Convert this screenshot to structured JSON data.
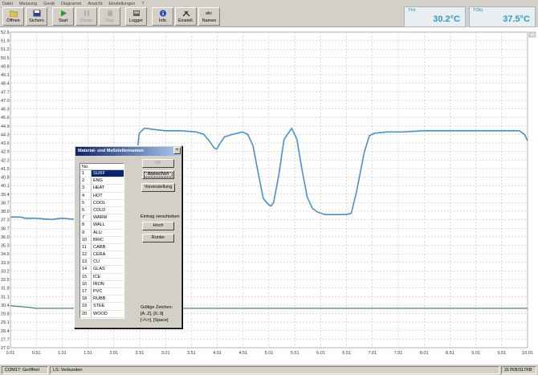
{
  "menu": [
    "Datei",
    "Messung",
    "Gerät",
    "Diagramm",
    "Ansicht",
    "Einstellungen",
    "?"
  ],
  "toolbar": [
    {
      "label": "Öffnen",
      "icon": "folder-icon",
      "enabled": true
    },
    {
      "label": "Sichern",
      "icon": "save-icon",
      "enabled": true
    },
    {
      "label": "Start",
      "icon": "play-icon",
      "enabled": true
    },
    {
      "label": "Pause",
      "icon": "pause-icon",
      "enabled": false
    },
    {
      "label": "Stop",
      "icon": "stop-icon",
      "enabled": false
    },
    {
      "label": "Logger",
      "icon": "logger-icon",
      "enabled": true
    },
    {
      "label": "Info",
      "icon": "info-icon",
      "enabled": true
    },
    {
      "label": "Einstell.",
      "icon": "tools-icon",
      "enabled": true
    },
    {
      "label": "Namen",
      "icon": "names-icon",
      "enabled": true
    }
  ],
  "readouts": [
    {
      "caption": "TInt",
      "value": "30.2°C"
    },
    {
      "caption": "TObj",
      "value": "37.5°C"
    }
  ],
  "colors": {
    "series1": "#4a90c8",
    "series2": "#2e7d5a",
    "accent": "#2aa0c0",
    "title_bar": "#0a246a"
  },
  "chart_data": {
    "type": "line",
    "ylim": [
      27.0,
      52.6
    ],
    "xlim": [
      0.01,
      10.01
    ],
    "y_ticks": [
      "52.6",
      "51.9",
      "51.2",
      "50.5",
      "49.8",
      "49.1",
      "48.4",
      "47.7",
      "47.0",
      "46.3",
      "45.6",
      "44.9",
      "44.3",
      "43.6",
      "42.9",
      "42.2",
      "41.5",
      "40.8",
      "40.1",
      "39.4",
      "38.7",
      "38.0",
      "37.3",
      "36.7",
      "36.0",
      "35.3",
      "34.6",
      "33.9",
      "33.2",
      "32.5",
      "31.8",
      "31.1",
      "30.4",
      "29.8",
      "29.1",
      "28.4",
      "27.7",
      "27.0"
    ],
    "x_ticks": [
      "0.01",
      "0.51",
      "1.01",
      "1.51",
      "2.01",
      "2.51",
      "3.01",
      "3.51",
      "4.01",
      "4.51",
      "5.01",
      "5.51",
      "6.01",
      "6.51",
      "7.01",
      "7.51",
      "8.01",
      "8.51",
      "9.01",
      "9.51",
      "10.01"
    ],
    "grid": true,
    "series": [
      {
        "x": [
          0.01,
          0.2,
          0.3,
          0.5,
          0.8,
          1.0,
          1.3,
          1.6,
          1.9,
          2.1,
          2.3,
          2.4,
          2.5,
          2.6,
          2.8,
          3.0,
          3.3,
          3.6,
          3.75,
          3.85,
          3.95,
          4.0,
          4.05,
          4.15,
          4.3,
          4.5,
          4.6,
          4.7,
          4.8,
          4.9,
          5.0,
          5.05,
          5.1,
          5.2,
          5.3,
          5.45,
          5.55,
          5.65,
          5.75,
          5.85,
          5.95,
          6.1,
          6.3,
          6.5,
          6.6,
          6.7,
          6.85,
          6.95,
          7.05,
          7.3,
          7.6,
          8.0,
          8.5,
          9.0,
          9.5,
          9.85,
          9.95,
          10.01
        ],
        "y": [
          37.6,
          37.6,
          37.5,
          37.5,
          37.4,
          37.5,
          37.4,
          37.5,
          37.5,
          37.6,
          37.8,
          40.5,
          44.4,
          44.8,
          44.7,
          44.6,
          44.6,
          44.5,
          44.3,
          43.8,
          43.2,
          43.1,
          43.5,
          44.1,
          44.3,
          44.5,
          44.3,
          43.4,
          41.2,
          39.1,
          38.6,
          38.5,
          38.8,
          41.0,
          43.9,
          44.8,
          43.9,
          41.4,
          39.2,
          38.3,
          38.0,
          37.8,
          37.8,
          37.8,
          37.9,
          39.6,
          42.8,
          44.2,
          44.4,
          44.5,
          44.5,
          44.6,
          44.6,
          44.6,
          44.6,
          44.6,
          44.3,
          43.8
        ]
      },
      {
        "x": [
          0.01,
          0.3,
          0.5,
          1.0,
          2.0,
          3.0,
          4.0,
          5.0,
          6.0,
          7.0,
          8.0,
          9.0,
          10.01
        ],
        "y": [
          30.4,
          30.3,
          30.2,
          30.2,
          30.2,
          30.2,
          30.2,
          30.2,
          30.2,
          30.2,
          30.2,
          30.2,
          30.2
        ]
      }
    ]
  },
  "dialog": {
    "title": "Material- und Meßstellennamen",
    "close_label": "×",
    "list_header": "No.",
    "items": [
      {
        "no": "1",
        "name": "SURF"
      },
      {
        "no": "2",
        "name": "ENG"
      },
      {
        "no": "3",
        "name": "HEAT"
      },
      {
        "no": "4",
        "name": "HOT"
      },
      {
        "no": "5",
        "name": "COOL"
      },
      {
        "no": "6",
        "name": "COLD"
      },
      {
        "no": "7",
        "name": "WARM"
      },
      {
        "no": "8",
        "name": "WALL"
      },
      {
        "no": "9",
        "name": "ALU"
      },
      {
        "no": "10",
        "name": "BRIC"
      },
      {
        "no": "11",
        "name": "CARB"
      },
      {
        "no": "12",
        "name": "CERA"
      },
      {
        "no": "13",
        "name": "CU"
      },
      {
        "no": "14",
        "name": "GLAS"
      },
      {
        "no": "15",
        "name": "ICE"
      },
      {
        "no": "16",
        "name": "IRON"
      },
      {
        "no": "17",
        "name": "PVC"
      },
      {
        "no": "18",
        "name": "RUBB"
      },
      {
        "no": "19",
        "name": "STEE"
      },
      {
        "no": "20",
        "name": "WOOD"
      }
    ],
    "selected_index": 0,
    "ok_label": "OK",
    "cancel_label": "Abbrechen",
    "default_label": "Voreinstellung",
    "move_label": "Eintrag verschieben",
    "up_label": "Hoch",
    "down_label": "Runter",
    "valid_chars_label": "Gültige Zeichen:",
    "valid_chars_1": "[A..Z], [0..9]",
    "valid_chars_2": "[-/<>], [Space]"
  },
  "statusbar": {
    "port": "COM17: Geöffnet",
    "connection": "LS: Verbunden",
    "counter": "317KB/317KB"
  }
}
